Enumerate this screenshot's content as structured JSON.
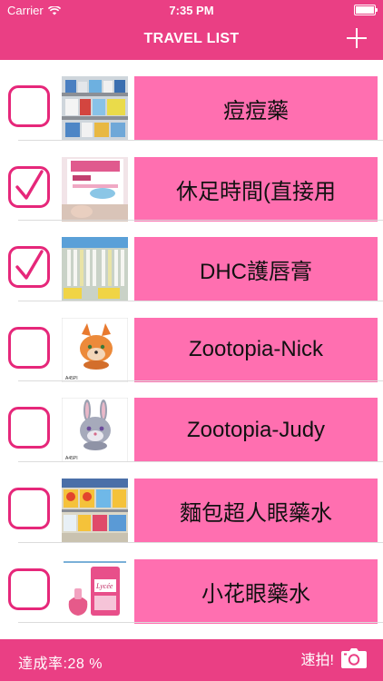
{
  "status": {
    "carrier": "Carrier",
    "time": "7:35 PM"
  },
  "nav": {
    "title": "TRAVEL LIST",
    "add_icon": "plus-icon"
  },
  "items": [
    {
      "label": "痘痘藥",
      "checked": false,
      "thumb": "drugstore-shelf"
    },
    {
      "label": "休足時間(直接用",
      "checked": true,
      "thumb": "foot-patch-box"
    },
    {
      "label": "DHC護唇膏",
      "checked": true,
      "thumb": "lip-balm-shelf"
    },
    {
      "label": "Zootopia-Nick",
      "checked": false,
      "thumb": "fox-plush"
    },
    {
      "label": "Zootopia-Judy",
      "checked": false,
      "thumb": "bunny-plush"
    },
    {
      "label": "麵包超人眼藥水",
      "checked": false,
      "thumb": "eyedrop-shelf"
    },
    {
      "label": "小花眼藥水",
      "checked": false,
      "thumb": "lycee-eyedrop"
    }
  ],
  "footer": {
    "progress": "達成率:28 %",
    "snap_label": "速拍!",
    "snap_icon": "camera-icon"
  },
  "colors": {
    "brand": "#ea3f84",
    "button": "#ff6fb0",
    "check": "#e6277a"
  }
}
